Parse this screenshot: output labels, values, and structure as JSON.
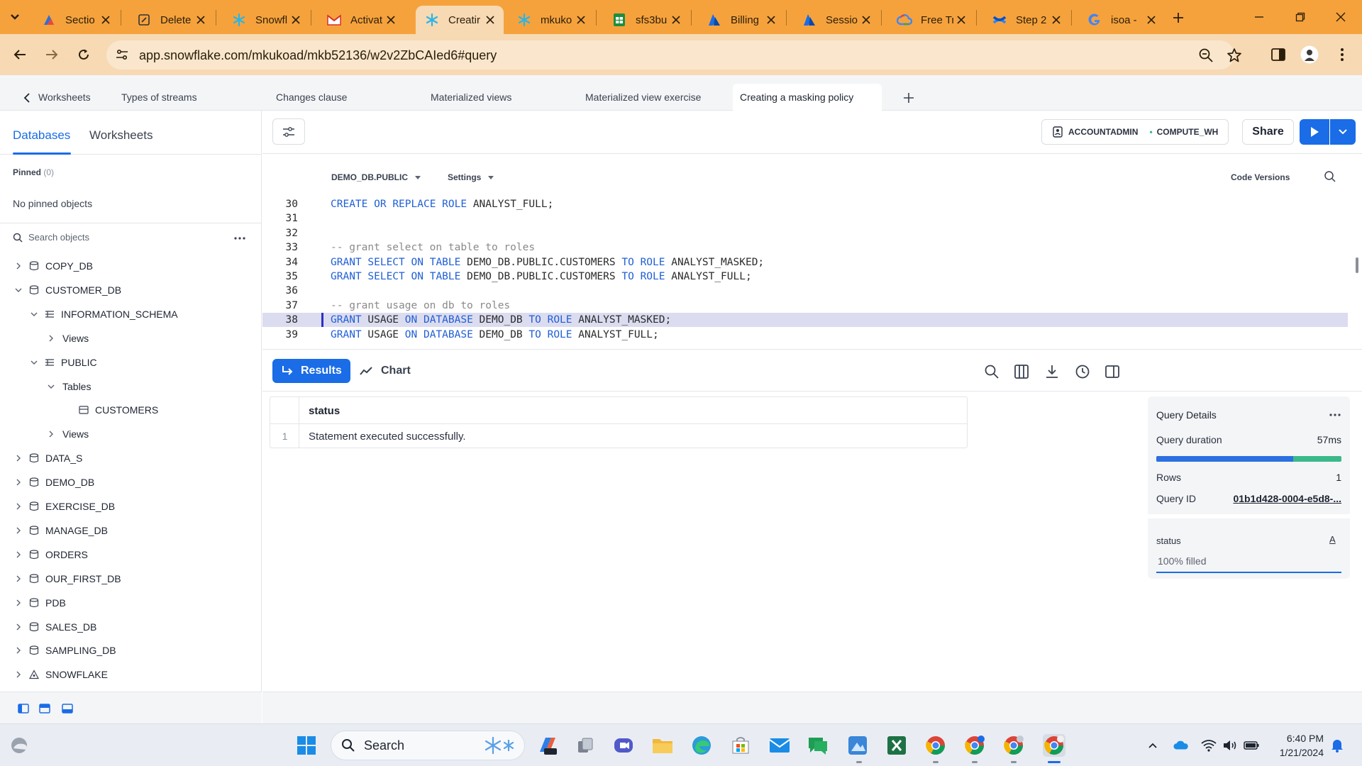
{
  "browser": {
    "tabs": [
      {
        "title": "Sectio",
        "icon": "salesforce-trailhead-icon"
      },
      {
        "title": "Delete",
        "icon": "edit-page-icon"
      },
      {
        "title": "Snowfl",
        "icon": "snowflake-icon"
      },
      {
        "title": "Activat",
        "icon": "gmail-icon"
      },
      {
        "title": "Creatir",
        "icon": "snowflake-icon",
        "active": true
      },
      {
        "title": "mkuko",
        "icon": "snowflake-icon"
      },
      {
        "title": "sfs3bu",
        "icon": "sheets-icon"
      },
      {
        "title": "Billing",
        "icon": "azure-icon"
      },
      {
        "title": "Sessio",
        "icon": "azure-icon"
      },
      {
        "title": "Free Tr",
        "icon": "google-cloud-icon"
      },
      {
        "title": "Step 2",
        "icon": "confluence-icon"
      },
      {
        "title": "isoa - ",
        "icon": "google-icon"
      }
    ],
    "url": "app.snowflake.com/mkukoad/mkb52136/w2v2ZbCAIed6#query"
  },
  "worksheet_tabs": [
    {
      "label": "Worksheets"
    },
    {
      "label": "Types of streams"
    },
    {
      "label": "Changes clause"
    },
    {
      "label": "Materialized views"
    },
    {
      "label": "Materialized view exercise"
    },
    {
      "label": "Creating a masking policy",
      "active": true
    }
  ],
  "sidebar": {
    "tabs": [
      "Databases",
      "Worksheets"
    ],
    "active_tab": "Databases",
    "pinned_label": "Pinned",
    "pinned_count": "(0)",
    "no_pinned": "No pinned objects",
    "search_placeholder": "Search objects",
    "tree": [
      {
        "label": "COPY_DB",
        "level": 0,
        "state": "collapsed",
        "icon": "database-icon"
      },
      {
        "label": "CUSTOMER_DB",
        "level": 0,
        "state": "expanded",
        "icon": "database-icon"
      },
      {
        "label": "INFORMATION_SCHEMA",
        "level": 1,
        "state": "expanded",
        "icon": "schema-icon"
      },
      {
        "label": "Views",
        "level": 2,
        "state": "collapsed",
        "icon": ""
      },
      {
        "label": "PUBLIC",
        "level": 1,
        "state": "expanded",
        "icon": "schema-icon"
      },
      {
        "label": "Tables",
        "level": 2,
        "state": "expanded",
        "icon": ""
      },
      {
        "label": "CUSTOMERS",
        "level": 3,
        "state": "leaf",
        "icon": "table-icon"
      },
      {
        "label": "Views",
        "level": 2,
        "state": "collapsed",
        "icon": ""
      },
      {
        "label": "DATA_S",
        "level": 0,
        "state": "collapsed",
        "icon": "database-icon"
      },
      {
        "label": "DEMO_DB",
        "level": 0,
        "state": "collapsed",
        "icon": "database-icon"
      },
      {
        "label": "EXERCISE_DB",
        "level": 0,
        "state": "collapsed",
        "icon": "database-icon"
      },
      {
        "label": "MANAGE_DB",
        "level": 0,
        "state": "collapsed",
        "icon": "database-icon"
      },
      {
        "label": "ORDERS",
        "level": 0,
        "state": "collapsed",
        "icon": "database-icon"
      },
      {
        "label": "OUR_FIRST_DB",
        "level": 0,
        "state": "collapsed",
        "icon": "database-icon"
      },
      {
        "label": "PDB",
        "level": 0,
        "state": "collapsed",
        "icon": "database-icon"
      },
      {
        "label": "SALES_DB",
        "level": 0,
        "state": "collapsed",
        "icon": "database-icon"
      },
      {
        "label": "SAMPLING_DB",
        "level": 0,
        "state": "collapsed",
        "icon": "database-icon"
      },
      {
        "label": "SNOWFLAKE",
        "level": 0,
        "state": "collapsed",
        "icon": "shared-database-icon"
      }
    ]
  },
  "header": {
    "role": "ACCOUNTADMIN",
    "warehouse": "COMPUTE_WH",
    "share_label": "Share"
  },
  "editor": {
    "database_context": "DEMO_DB.PUBLIC",
    "settings_label": "Settings",
    "code_versions_label": "Code Versions",
    "current_line": 38,
    "lines": [
      {
        "n": 30,
        "tokens": [
          {
            "t": "CREATE",
            "k": "kw"
          },
          {
            "t": " "
          },
          {
            "t": "OR",
            "k": "kw"
          },
          {
            "t": " "
          },
          {
            "t": "REPLACE",
            "k": "kw"
          },
          {
            "t": " "
          },
          {
            "t": "ROLE",
            "k": "kw"
          },
          {
            "t": " ANALYST_FULL;"
          }
        ]
      },
      {
        "n": 31,
        "tokens": []
      },
      {
        "n": 32,
        "tokens": []
      },
      {
        "n": 33,
        "tokens": [
          {
            "t": "-- grant select on table to roles",
            "k": "cm"
          }
        ]
      },
      {
        "n": 34,
        "tokens": [
          {
            "t": "GRANT",
            "k": "kw"
          },
          {
            "t": " "
          },
          {
            "t": "SELECT",
            "k": "kw"
          },
          {
            "t": " "
          },
          {
            "t": "ON",
            "k": "kw"
          },
          {
            "t": " "
          },
          {
            "t": "TABLE",
            "k": "kw"
          },
          {
            "t": " DEMO_DB.PUBLIC.CUSTOMERS "
          },
          {
            "t": "TO",
            "k": "kw"
          },
          {
            "t": " "
          },
          {
            "t": "ROLE",
            "k": "kw"
          },
          {
            "t": " ANALYST_MASKED;"
          }
        ]
      },
      {
        "n": 35,
        "tokens": [
          {
            "t": "GRANT",
            "k": "kw"
          },
          {
            "t": " "
          },
          {
            "t": "SELECT",
            "k": "kw"
          },
          {
            "t": " "
          },
          {
            "t": "ON",
            "k": "kw"
          },
          {
            "t": " "
          },
          {
            "t": "TABLE",
            "k": "kw"
          },
          {
            "t": " DEMO_DB.PUBLIC.CUSTOMERS "
          },
          {
            "t": "TO",
            "k": "kw"
          },
          {
            "t": " "
          },
          {
            "t": "ROLE",
            "k": "kw"
          },
          {
            "t": " ANALYST_FULL;"
          }
        ]
      },
      {
        "n": 36,
        "tokens": []
      },
      {
        "n": 37,
        "tokens": [
          {
            "t": "-- grant usage on db to roles",
            "k": "cm"
          }
        ]
      },
      {
        "n": 38,
        "tokens": [
          {
            "t": "GRANT",
            "k": "kw"
          },
          {
            "t": " USAGE "
          },
          {
            "t": "ON",
            "k": "kw"
          },
          {
            "t": " "
          },
          {
            "t": "DATABASE",
            "k": "kw"
          },
          {
            "t": " DEMO_DB "
          },
          {
            "t": "TO",
            "k": "kw"
          },
          {
            "t": " "
          },
          {
            "t": "ROLE",
            "k": "kw"
          },
          {
            "t": " ANALYST_MASKED;"
          }
        ]
      },
      {
        "n": 39,
        "tokens": [
          {
            "t": "GRANT",
            "k": "kw"
          },
          {
            "t": " USAGE "
          },
          {
            "t": "ON",
            "k": "kw"
          },
          {
            "t": " "
          },
          {
            "t": "DATABASE",
            "k": "kw"
          },
          {
            "t": " DEMO_DB "
          },
          {
            "t": "TO",
            "k": "kw"
          },
          {
            "t": " "
          },
          {
            "t": "ROLE",
            "k": "kw"
          },
          {
            "t": " ANALYST_FULL;"
          }
        ]
      }
    ]
  },
  "results": {
    "results_label": "Results",
    "chart_label": "Chart",
    "columns": [
      "status"
    ],
    "rows": [
      {
        "index": "1",
        "status": "Statement executed successfully."
      }
    ]
  },
  "query_details": {
    "title": "Query Details",
    "duration_label": "Query duration",
    "duration_value": "57ms",
    "duration_split": 0.74,
    "rows_label": "Rows",
    "rows_value": "1",
    "id_label": "Query ID",
    "id_value": "01b1d428-0004-e5d8-...",
    "column_card": {
      "title": "status",
      "type_glyph": "A",
      "fill_text": "100% filled",
      "fill_fraction": 1.0
    }
  },
  "taskbar": {
    "search_placeholder": "Search",
    "time": "6:40 PM",
    "date": "1/21/2024"
  },
  "colors": {
    "accent": "#1a6ce7",
    "chrome_tabstrip": "#f5a23d",
    "chrome_toolbar": "#f7d9b3",
    "keyword": "#1f5fd6",
    "comment": "#8a8a8a",
    "line_highlight": "#dcdcf0"
  }
}
